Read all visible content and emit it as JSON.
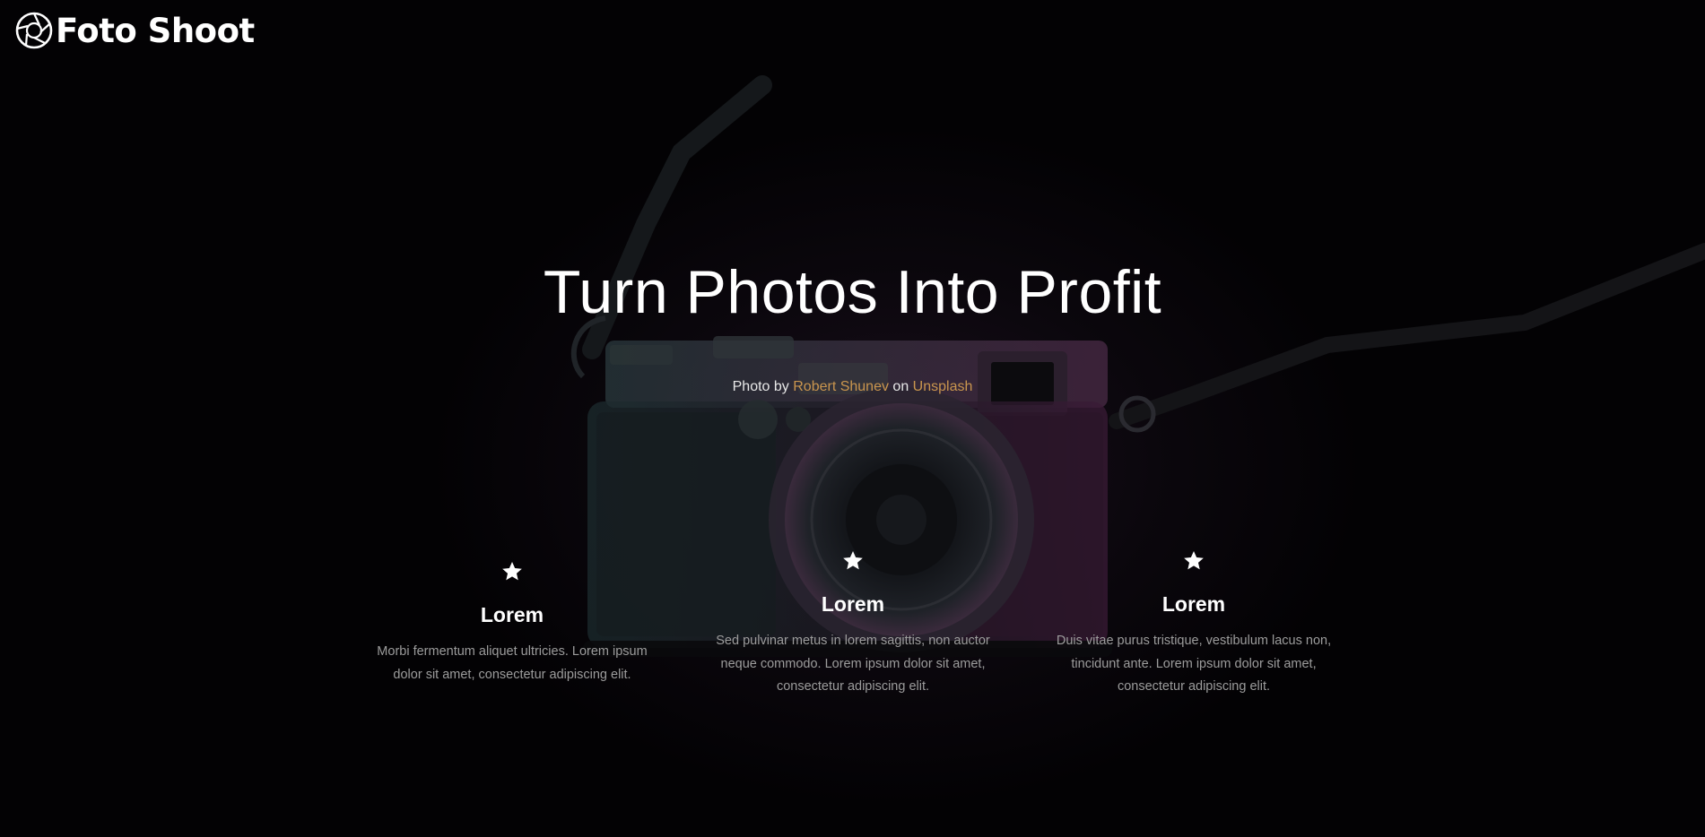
{
  "brand": {
    "name": "Foto Shoot",
    "logo_icon": "camera-aperture-icon"
  },
  "hero": {
    "headline": "Turn Photos Into Profit",
    "credit": {
      "prefix": "Photo by",
      "author": "Robert Shunev",
      "connector": "on",
      "source": "Unsplash"
    }
  },
  "features": [
    {
      "icon": "star-icon",
      "title": "Lorem",
      "text": "Morbi fermentum aliquet ultricies. Lorem ipsum dolor sit amet, consectetur adipiscing elit."
    },
    {
      "icon": "star-icon",
      "title": "Lorem",
      "text": "Sed pulvinar metus in lorem sagittis, non auctor neque commodo. Lorem ipsum dolor sit amet, consectetur adipiscing elit."
    },
    {
      "icon": "star-icon",
      "title": "Lorem",
      "text": "Duis vitae purus tristique, vestibulum lacus non, tincidunt ante. Lorem ipsum dolor sit amet, consectetur adipiscing elit."
    }
  ],
  "colors": {
    "background": "#030204",
    "link_accent": "#c9954e",
    "body_text": "#9c9c9c",
    "heading": "#ffffff"
  }
}
